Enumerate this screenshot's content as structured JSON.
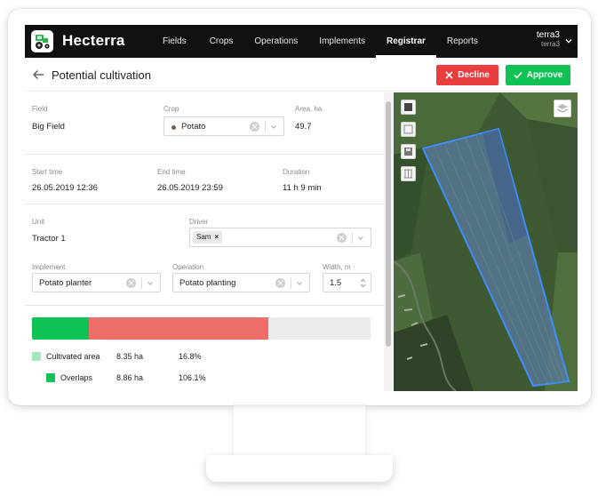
{
  "nav": {
    "brand": "Hecterra",
    "items": [
      "Fields",
      "Crops",
      "Operations",
      "Implements",
      "Registrar",
      "Reports"
    ],
    "active": "Registrar",
    "user_name": "terra3",
    "user_sub": "terra3"
  },
  "header": {
    "title": "Potential cultivation",
    "decline_label": "Decline",
    "approve_label": "Approve"
  },
  "form": {
    "field_label": "Field",
    "field_value": "Big Field",
    "crop_label": "Crop",
    "crop_value": "Potato",
    "area_label": "Area, ha",
    "area_value": "49.7",
    "start_label": "Start time",
    "start_value": "26.05.2019 12:36",
    "end_label": "End time",
    "end_value": "26.05.2019 23:59",
    "duration_label": "Duration",
    "duration_value": "11 h 9 min",
    "unit_label": "Unit",
    "unit_value": "Tractor 1",
    "driver_label": "Driver",
    "driver_tag": "Sam",
    "implement_label": "Implement",
    "implement_value": "Potato planter",
    "operation_label": "Operation",
    "operation_value": "Potato planting",
    "width_label": "Width, m",
    "width_value": "1.5"
  },
  "stats": {
    "cultivated_fraction": 0.168,
    "overlap_fraction_of_bar": 0.531,
    "rows": [
      {
        "label": "Cultivated area",
        "ha": "8.35 ha",
        "pct": "16.8%"
      },
      {
        "label": "Overlaps",
        "ha": "8.86 ha",
        "pct": "106.1%"
      }
    ]
  },
  "colors": {
    "cultivated": "#10c155",
    "overlap": "#ee6e6a",
    "cultivated_legend": "#a6e7bd",
    "decline": "#ea3d3d",
    "approve": "#10c155"
  },
  "map": {
    "tools": [
      "satellite-view-icon",
      "draw-icon",
      "save-icon",
      "grid-icon"
    ],
    "layers_icon": "layers-icon"
  }
}
